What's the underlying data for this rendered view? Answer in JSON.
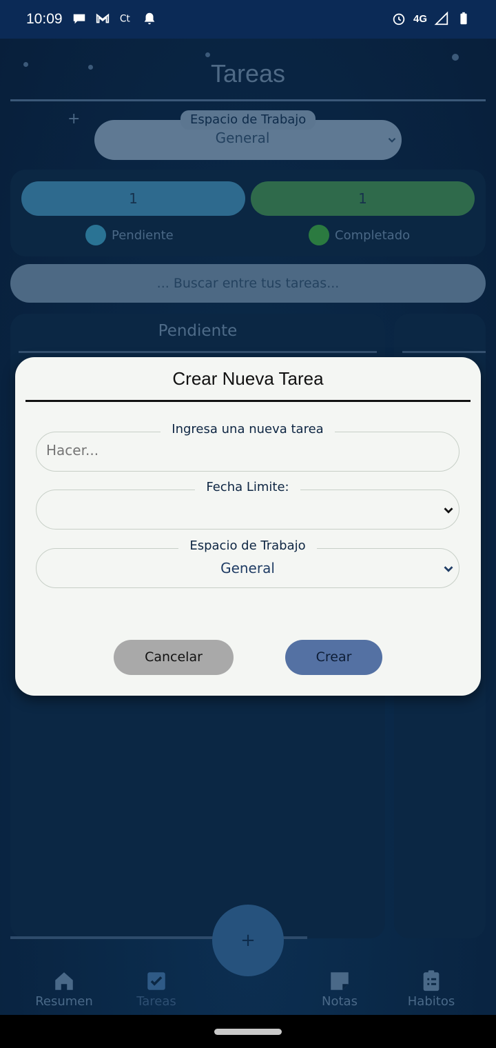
{
  "status_bar": {
    "time": "10:09",
    "network": "4G"
  },
  "app": {
    "title": "Tareas",
    "add_symbol": "+",
    "workspace": {
      "label": "Espacio de Trabajo",
      "value": "General"
    },
    "stats": {
      "pending_count": "1",
      "completed_count": "1",
      "pending_label": "Pendiente",
      "completed_label": "Completado"
    },
    "search": {
      "placeholder": "... Buscar entre tus tareas..."
    },
    "columns": [
      {
        "title": "Pendiente"
      }
    ],
    "colors": {
      "pending": "#2f7fa8",
      "completed": "#2e8a4a"
    }
  },
  "bottom_nav": {
    "items": [
      {
        "label": "Resumen",
        "icon": "home-icon"
      },
      {
        "label": "Tareas",
        "icon": "checkbox-icon"
      },
      {
        "label": "Notas",
        "icon": "note-icon"
      },
      {
        "label": "Habitos",
        "icon": "clipboard-list-icon"
      }
    ],
    "fab_label": "+"
  },
  "modal": {
    "title": "Crear Nueva Tarea",
    "task_field": {
      "label": "Ingresa una nueva tarea",
      "placeholder": "Hacer...",
      "value": ""
    },
    "deadline_field": {
      "label": "Fecha Limite:",
      "value": ""
    },
    "workspace_field": {
      "label": "Espacio de Trabajo",
      "value": "General"
    },
    "cancel_label": "Cancelar",
    "create_label": "Crear",
    "colors": {
      "create_button": "#5471a3",
      "cancel_button": "#a9a9a9"
    }
  }
}
